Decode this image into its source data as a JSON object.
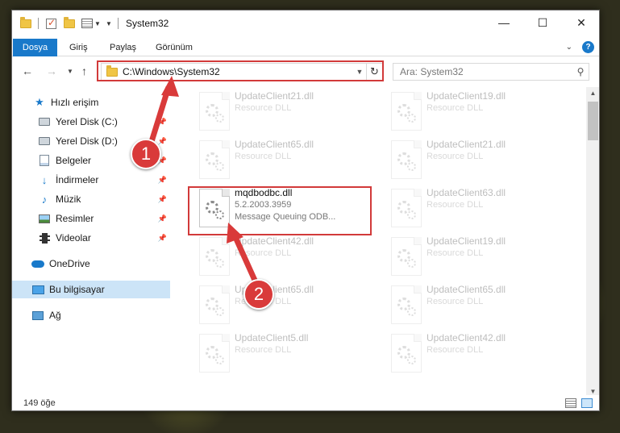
{
  "window": {
    "title": "System32",
    "controls": {
      "minimize": "—",
      "maximize": "☐",
      "close": "✕"
    }
  },
  "ribbon": {
    "tabs": [
      "Dosya",
      "Giriş",
      "Paylaş",
      "Görünüm"
    ],
    "help": "?"
  },
  "address": {
    "path": "C:\\Windows\\System32",
    "search_placeholder": "Ara: System32"
  },
  "sidebar": {
    "items": [
      {
        "label": "Hızlı erişim",
        "icon": "star-icon"
      },
      {
        "label": "Yerel Disk (C:)",
        "icon": "drive-icon"
      },
      {
        "label": "Yerel Disk (D:)",
        "icon": "drive-icon"
      },
      {
        "label": "Belgeler",
        "icon": "documents-icon"
      },
      {
        "label": "İndirmeler",
        "icon": "downloads-icon"
      },
      {
        "label": "Müzik",
        "icon": "music-icon"
      },
      {
        "label": "Resimler",
        "icon": "pictures-icon"
      },
      {
        "label": "Videolar",
        "icon": "videos-icon"
      },
      {
        "label": "OneDrive",
        "icon": "onedrive-icon"
      },
      {
        "label": "Bu bilgisayar",
        "icon": "this-pc-icon"
      },
      {
        "label": "Ağ",
        "icon": "network-icon"
      }
    ]
  },
  "files": {
    "left": [
      {
        "name": "UpdateClient21.dll",
        "line1": "Resource DLL",
        "line2": ""
      },
      {
        "name": "UpdateClient65.dll",
        "line1": "Resource DLL",
        "line2": ""
      },
      {
        "name": "mqdbodbc.dll",
        "line1": "5.2.2003.3959",
        "line2": "Message Queuing ODB..."
      },
      {
        "name": "UpdateClient42.dll",
        "line1": "Resource DLL",
        "line2": ""
      },
      {
        "name": "UpdateClient65.dll",
        "line1": "Resource DLL",
        "line2": ""
      },
      {
        "name": "UpdateClient5.dll",
        "line1": "Resource DLL",
        "line2": ""
      }
    ],
    "right": [
      {
        "name": "UpdateClient19.dll",
        "line1": "Resource DLL"
      },
      {
        "name": "UpdateClient21.dll",
        "line1": "Resource DLL"
      },
      {
        "name": "UpdateClient63.dll",
        "line1": "Resource DLL"
      },
      {
        "name": "UpdateClient19.dll",
        "line1": "Resource DLL"
      },
      {
        "name": "UpdateClient65.dll",
        "line1": "Resource DLL"
      },
      {
        "name": "UpdateClient42.dll",
        "line1": "Resource DLL"
      }
    ]
  },
  "status": {
    "count": "149 öğe"
  },
  "callouts": {
    "one": "1",
    "two": "2"
  },
  "colors": {
    "accent": "#1979ca",
    "callout": "#d93a3a",
    "selected": "#cce4f7"
  }
}
